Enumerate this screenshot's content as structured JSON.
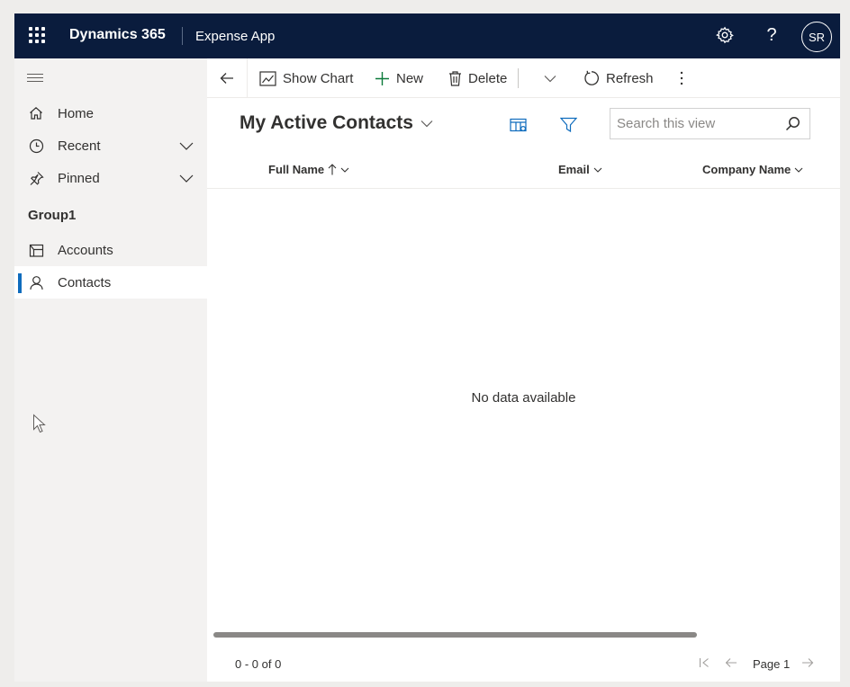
{
  "topbar": {
    "brand": "Dynamics 365",
    "app_name": "Expense App",
    "avatar_initials": "SR",
    "icons": [
      "waffle-icon",
      "settings-gear-icon",
      "help-question-icon"
    ]
  },
  "sidebar": {
    "items": [
      {
        "label": "Home",
        "icon": "home-icon"
      },
      {
        "label": "Recent",
        "icon": "clock-icon"
      },
      {
        "label": "Pinned",
        "icon": "pin-icon"
      }
    ],
    "group_label": "Group1",
    "group_items": [
      {
        "label": "Accounts",
        "icon": "accounts-icon"
      },
      {
        "label": "Contacts",
        "icon": "contact-person-icon",
        "active": true
      }
    ]
  },
  "commandbar": {
    "show_chart": "Show Chart",
    "new": "New",
    "delete": "Delete",
    "refresh": "Refresh"
  },
  "view": {
    "title": "My Active Contacts",
    "search_placeholder": "Search this view"
  },
  "grid": {
    "columns": [
      "Full Name",
      "Email",
      "Company Name"
    ],
    "sort_column": "Full Name",
    "sort_direction": "ascending",
    "empty_message": "No data available"
  },
  "footer": {
    "record_count": "0 - 0 of 0",
    "page_label": "Page 1"
  },
  "colors": {
    "topbar_bg": "#0a1c3d",
    "accent": "#0f6cbd",
    "sidebar_bg": "#f3f2f1"
  }
}
